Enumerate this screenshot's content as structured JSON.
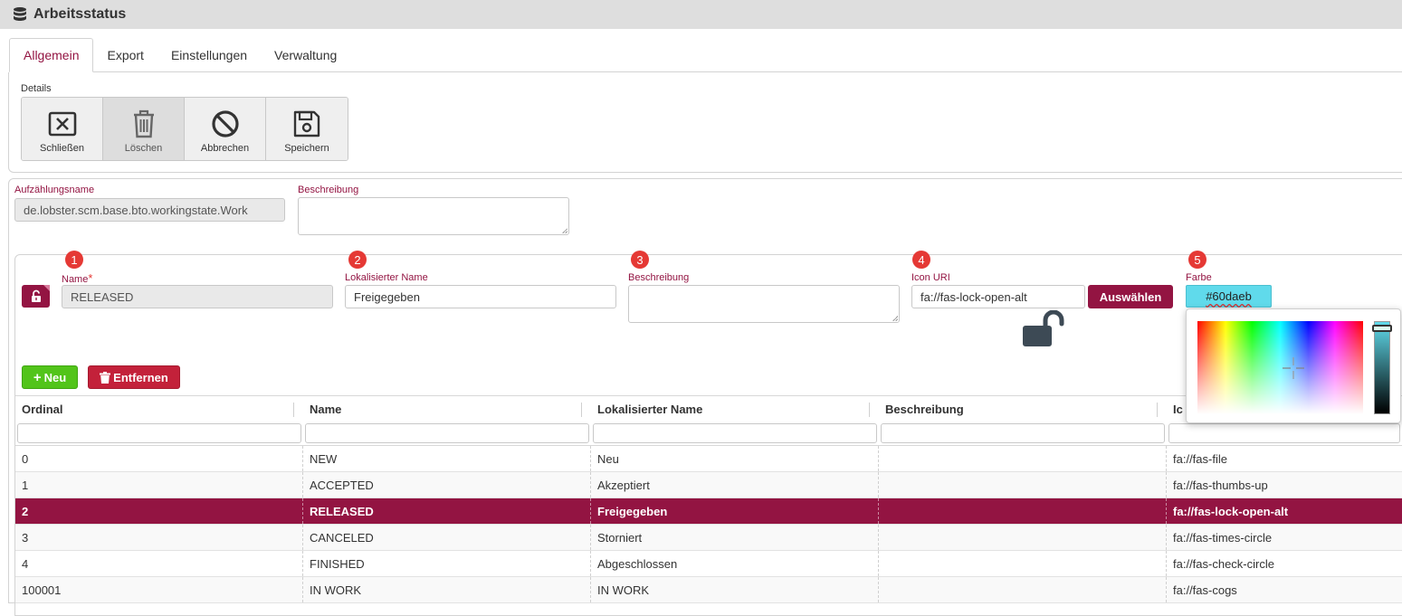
{
  "app": {
    "title": "Arbeitsstatus"
  },
  "tabs": [
    "Allgemein",
    "Export",
    "Einstellungen",
    "Verwaltung"
  ],
  "details": {
    "label": "Details",
    "buttons": [
      {
        "label": "Schließen",
        "icon": "close-box-icon"
      },
      {
        "label": "Löschen",
        "icon": "trash-icon"
      },
      {
        "label": "Abbrechen",
        "icon": "ban-icon"
      },
      {
        "label": "Speichern",
        "icon": "save-icon"
      }
    ]
  },
  "enum": {
    "name_label": "Aufzählungsname",
    "name_value": "de.lobster.scm.base.bto.workingstate.Work",
    "desc_label": "Beschreibung"
  },
  "entry": {
    "badges": [
      "1",
      "2",
      "3",
      "4",
      "5"
    ],
    "name_label": "Name",
    "required_mark": "*",
    "name_value": "RELEASED",
    "loc_label": "Lokalisierter Name",
    "loc_value": "Freigegeben",
    "desc_label": "Beschreibung",
    "icon_label": "Icon URI",
    "icon_value": "fa://fas-lock-open-alt",
    "select_button": "Auswählen",
    "color_label": "Farbe",
    "color_value": "#60daeb"
  },
  "actions": {
    "new": "Neu",
    "remove": "Entfernen"
  },
  "colors": {
    "accent": "#931442",
    "green": "#52c41a",
    "danger": "#c3213a",
    "picked": "#60daeb",
    "badge": "#e53935"
  },
  "grid": {
    "headers": [
      "Ordinal",
      "Name",
      "Lokalisierter Name",
      "Beschreibung",
      "Icon URI"
    ],
    "header_visible": [
      "Ordinal",
      "Name",
      "Lokalisierter Name",
      "Beschreibung",
      "Ic"
    ],
    "rows": [
      [
        "0",
        "NEW",
        "Neu",
        "",
        "fa://fas-file"
      ],
      [
        "1",
        "ACCEPTED",
        "Akzeptiert",
        "",
        "fa://fas-thumbs-up"
      ],
      [
        "2",
        "RELEASED",
        "Freigegeben",
        "",
        "fa://fas-lock-open-alt"
      ],
      [
        "3",
        "CANCELED",
        "Storniert",
        "",
        "fa://fas-times-circle"
      ],
      [
        "4",
        "FINISHED",
        "Abgeschlossen",
        "",
        "fa://fas-check-circle"
      ],
      [
        "100001",
        "IN WORK",
        "IN WORK",
        "",
        "fa://fas-cogs"
      ]
    ],
    "selected_row": 2
  }
}
